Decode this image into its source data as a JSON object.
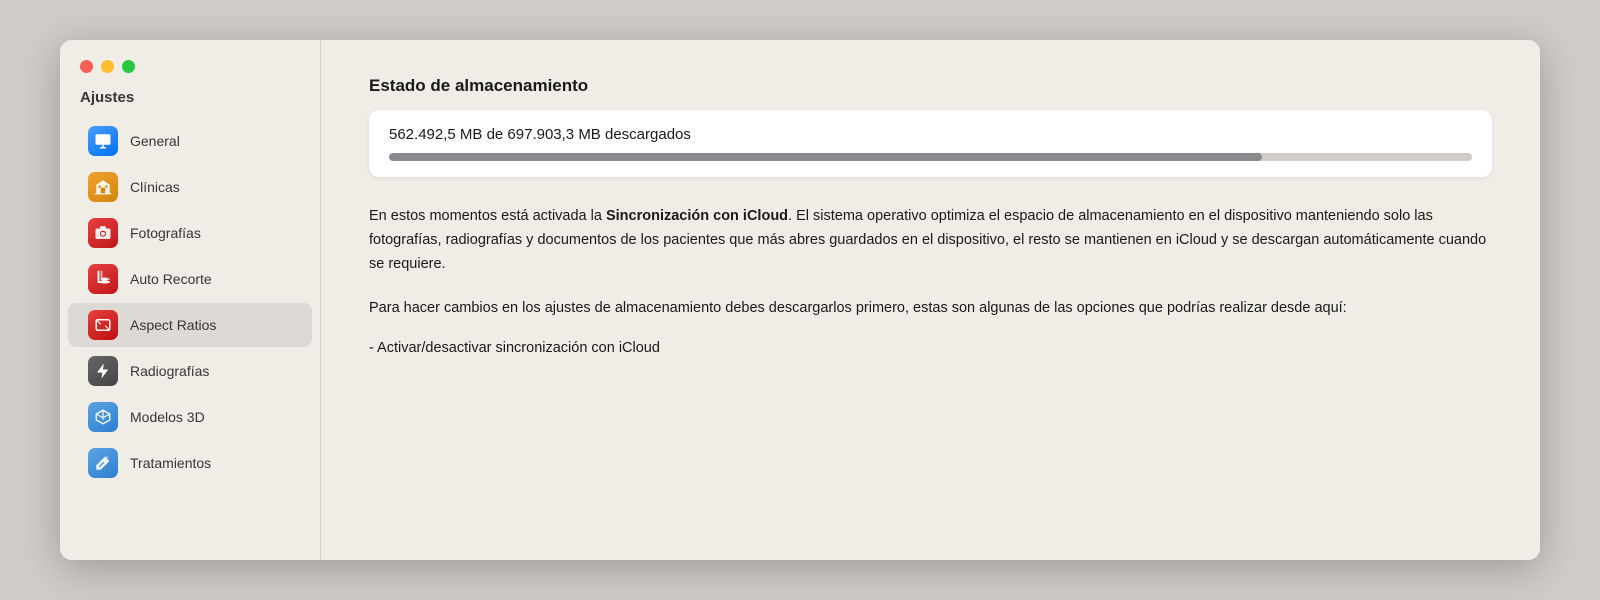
{
  "window": {
    "sidebar": {
      "title": "Ajustes",
      "items": [
        {
          "id": "general",
          "label": "General",
          "iconClass": "icon-general",
          "iconType": "monitor"
        },
        {
          "id": "clinicas",
          "label": "Clínicas",
          "iconClass": "icon-clinicas",
          "iconType": "building"
        },
        {
          "id": "fotografias",
          "label": "Fotografías",
          "iconClass": "icon-fotografias",
          "iconType": "camera"
        },
        {
          "id": "autorecorte",
          "label": "Auto Recorte",
          "iconClass": "icon-autorecorte",
          "iconType": "crop"
        },
        {
          "id": "aspectratios",
          "label": "Aspect Ratios",
          "iconClass": "icon-aspectratios",
          "iconType": "aspectratio",
          "active": true
        },
        {
          "id": "radiografias",
          "label": "Radiografías",
          "iconClass": "icon-radiografias",
          "iconType": "lightning"
        },
        {
          "id": "modelos3d",
          "label": "Modelos 3D",
          "iconClass": "icon-modelos3d",
          "iconType": "cube"
        },
        {
          "id": "tratamientos",
          "label": "Tratamientos",
          "iconClass": "icon-tratamientos",
          "iconType": "wrench"
        }
      ]
    },
    "main": {
      "sectionTitle": "Estado de almacenamiento",
      "storageLabel": "562.492,5 MB de 697.903,3 MB descargados",
      "progressPercent": 80.6,
      "description1Part1": "En estos momentos está activada la ",
      "description1Bold": "Sincronización con iCloud",
      "description1Part2": ". El sistema operativo optimiza el espacio de almacenamiento en el dispositivo manteniendo solo las fotografías, radiografías y documentos de los pacientes que más abres guardados en el dispositivo, el resto se mantienen en iCloud y se descargan automáticamente cuando se requiere.",
      "description2": "Para hacer cambios en los ajustes de almacenamiento debes descargarlos primero, estas son algunas de las opciones que podrías realizar desde aquí:",
      "option1": "- Activar/desactivar sincronización con iCloud"
    }
  }
}
